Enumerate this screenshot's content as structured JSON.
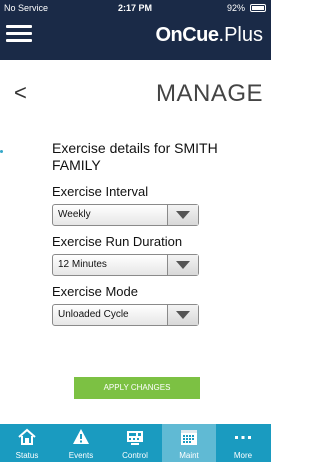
{
  "status": {
    "carrier": "No Service",
    "time": "2:17 PM",
    "battery": "92%"
  },
  "app": {
    "logo_bold": "OnCue",
    "logo_light": ".Plus"
  },
  "page": {
    "back_symbol": "<",
    "title": "MANAGE"
  },
  "form": {
    "heading": "Exercise details for SMITH FAMILY",
    "interval": {
      "label": "Exercise Interval",
      "value": "Weekly"
    },
    "duration": {
      "label": "Exercise Run Duration",
      "value": "12 Minutes"
    },
    "mode": {
      "label": "Exercise Mode",
      "value": "Unloaded Cycle"
    },
    "apply_label": "APPLY CHANGES"
  },
  "tabs": [
    {
      "label": "Status",
      "icon": "home-icon"
    },
    {
      "label": "Events",
      "icon": "warning-icon"
    },
    {
      "label": "Control",
      "icon": "control-panel-icon"
    },
    {
      "label": "Maint",
      "icon": "calendar-icon",
      "active": true
    },
    {
      "label": "More",
      "icon": "more-dots-icon"
    }
  ],
  "colors": {
    "header_bg": "#1a2a47",
    "tabbar_bg": "#1a9bc0",
    "active_tab": "#60bad4",
    "apply_bg": "#7cc143"
  }
}
